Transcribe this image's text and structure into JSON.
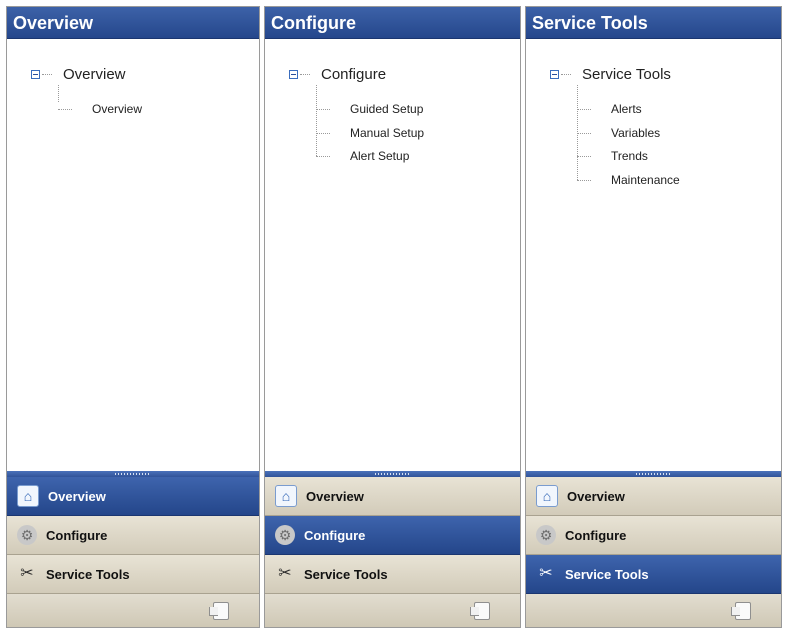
{
  "panels": [
    {
      "header": "Overview",
      "tree": {
        "root": "Overview",
        "children": [
          "Overview"
        ]
      },
      "nav": [
        "Overview",
        "Configure",
        "Service Tools"
      ],
      "active_nav": 0
    },
    {
      "header": "Configure",
      "tree": {
        "root": "Configure",
        "children": [
          "Guided Setup",
          "Manual Setup",
          "Alert Setup"
        ]
      },
      "nav": [
        "Overview",
        "Configure",
        "Service Tools"
      ],
      "active_nav": 1
    },
    {
      "header": "Service Tools",
      "tree": {
        "root": "Service Tools",
        "children": [
          "Alerts",
          "Variables",
          "Trends",
          "Maintenance"
        ]
      },
      "nav": [
        "Overview",
        "Configure",
        "Service Tools"
      ],
      "active_nav": 2
    }
  ],
  "nav_icons": [
    "home-icon",
    "gear-icon",
    "tools-icon"
  ],
  "colors": {
    "header_blue": "#2f539a",
    "active_nav_blue": "#2f539a",
    "nav_beige": "#ddd7c8"
  }
}
